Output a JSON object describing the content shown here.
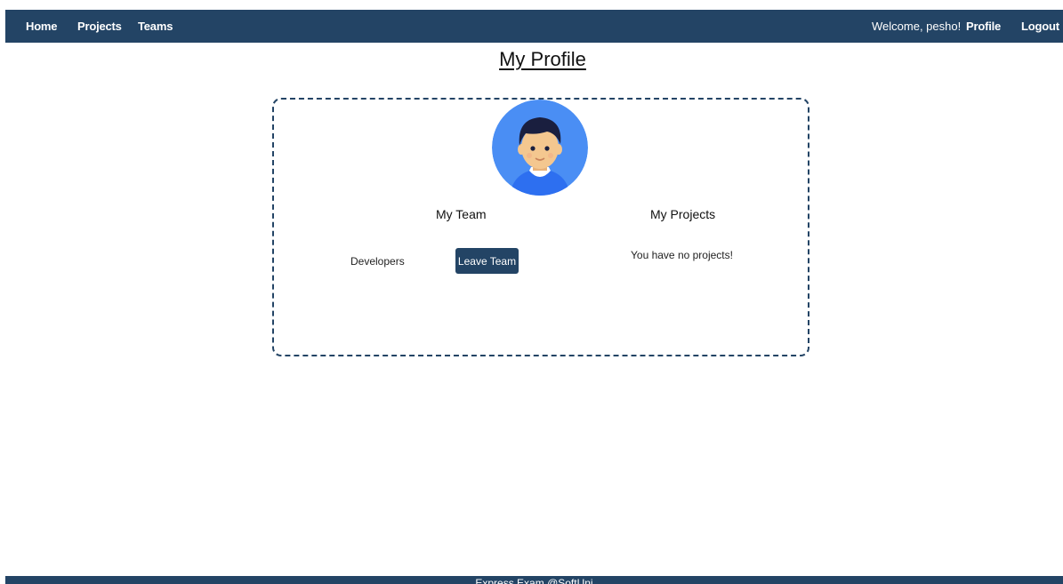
{
  "nav": {
    "home": "Home",
    "projects": "Projects",
    "teams": "Teams",
    "welcome": "Welcome, pesho!",
    "profile": "Profile",
    "logout": "Logout"
  },
  "page": {
    "title": "My Profile"
  },
  "team": {
    "heading": "My Team",
    "name": "Developers",
    "leave_label": "Leave Team"
  },
  "projects": {
    "heading": "My Projects",
    "empty_message": "You have no projects!"
  },
  "footer": {
    "text": "Express Exam @SoftUni"
  },
  "colors": {
    "brand": "#234465",
    "avatar_bg": "#4a8ef4",
    "hair": "#1a1f3f",
    "skin": "#f4c78f"
  },
  "icons": {
    "avatar": "user-avatar-icon"
  }
}
